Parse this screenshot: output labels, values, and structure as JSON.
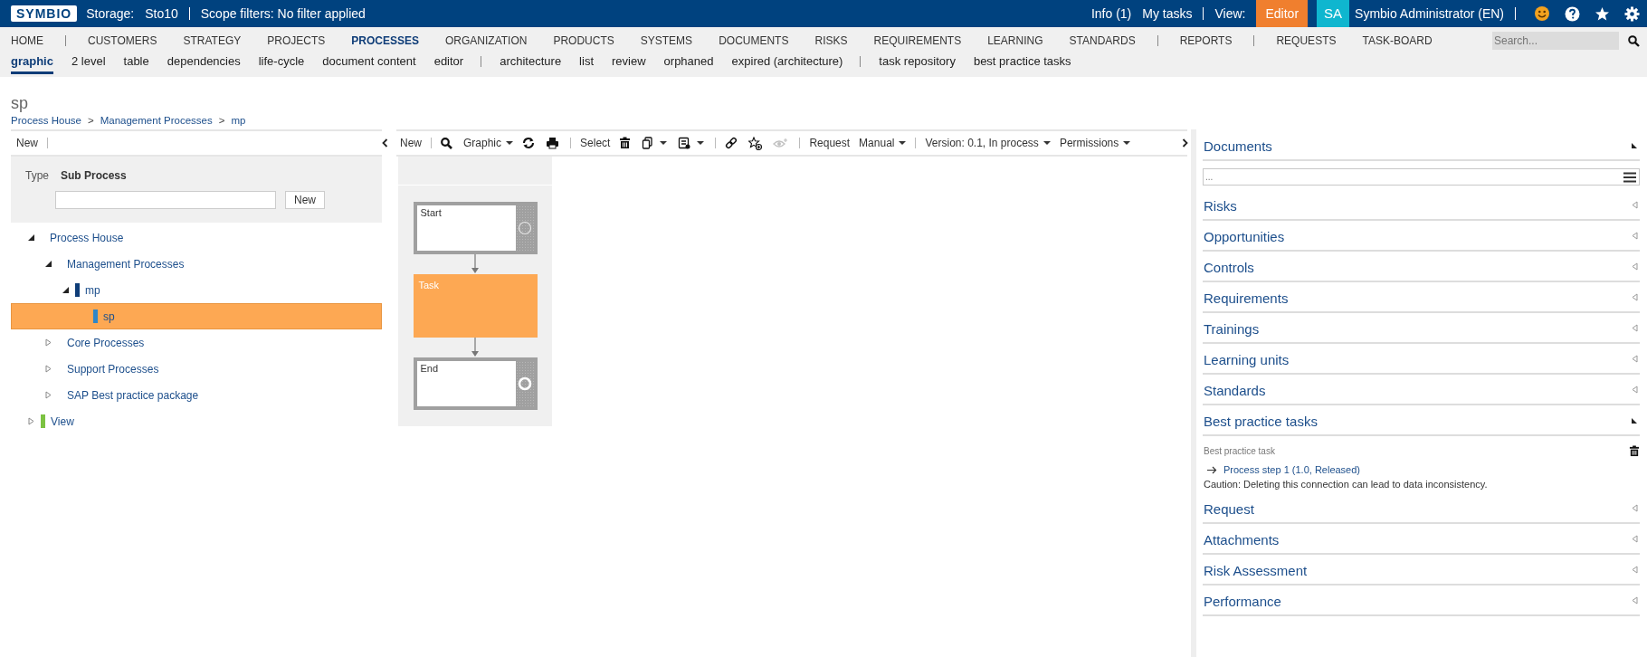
{
  "topbar": {
    "logo": "SYMBIO",
    "storage_label": "Storage:",
    "storage": "Sto10",
    "scope": "Scope filters: No filter applied",
    "info": "Info (1)",
    "my_tasks": "My tasks",
    "view_label": "View:",
    "view": "Editor",
    "avatar": "SA",
    "user": "Symbio Administrator (EN)"
  },
  "main_nav": [
    {
      "label": "HOME",
      "selected": false,
      "divider_after": true
    },
    {
      "label": "CUSTOMERS",
      "selected": false,
      "divider_after": false
    },
    {
      "label": "STRATEGY",
      "selected": false,
      "divider_after": false
    },
    {
      "label": "PROJECTS",
      "selected": false,
      "divider_after": false
    },
    {
      "label": "PROCESSES",
      "selected": true,
      "divider_after": false
    },
    {
      "label": "ORGANIZATION",
      "selected": false,
      "divider_after": false
    },
    {
      "label": "PRODUCTS",
      "selected": false,
      "divider_after": false
    },
    {
      "label": "SYSTEMS",
      "selected": false,
      "divider_after": false
    },
    {
      "label": "DOCUMENTS",
      "selected": false,
      "divider_after": false
    },
    {
      "label": "RISKS",
      "selected": false,
      "divider_after": false
    },
    {
      "label": "REQUIREMENTS",
      "selected": false,
      "divider_after": false
    },
    {
      "label": "LEARNING",
      "selected": false,
      "divider_after": false
    },
    {
      "label": "STANDARDS",
      "selected": false,
      "divider_after": true
    },
    {
      "label": "REPORTS",
      "selected": false,
      "divider_after": true
    },
    {
      "label": "REQUESTS",
      "selected": false,
      "divider_after": false
    },
    {
      "label": "TASK-BOARD",
      "selected": false,
      "divider_after": false
    }
  ],
  "search": {
    "placeholder": "Search..."
  },
  "sub_nav": [
    {
      "label": "graphic",
      "selected": true,
      "divider_after": false
    },
    {
      "label": "2 level",
      "selected": false,
      "divider_after": false
    },
    {
      "label": "table",
      "selected": false,
      "divider_after": false
    },
    {
      "label": "dependencies",
      "selected": false,
      "divider_after": false
    },
    {
      "label": "life-cycle",
      "selected": false,
      "divider_after": false
    },
    {
      "label": "document content",
      "selected": false,
      "divider_after": false
    },
    {
      "label": "editor",
      "selected": false,
      "divider_after": true
    },
    {
      "label": "architecture",
      "selected": false,
      "divider_after": false
    },
    {
      "label": "list",
      "selected": false,
      "divider_after": false
    },
    {
      "label": "review",
      "selected": false,
      "divider_after": false
    },
    {
      "label": "orphaned",
      "selected": false,
      "divider_after": false
    },
    {
      "label": "expired (architecture)",
      "selected": false,
      "divider_after": true
    },
    {
      "label": "task repository",
      "selected": false,
      "divider_after": false
    },
    {
      "label": "best practice tasks",
      "selected": false,
      "divider_after": false
    }
  ],
  "page": {
    "title": "sp",
    "breadcrumb": [
      "Process House",
      "Management Processes",
      "mp"
    ],
    "breadcrumb_separator": ">"
  },
  "left_panel": {
    "new_button": "New",
    "type_label": "Type",
    "type_value": "Sub Process",
    "create_button": "New",
    "tree": [
      {
        "label": "Process House",
        "expanded": true,
        "selected": false,
        "children": [
          {
            "label": "Management Processes",
            "expanded": true,
            "selected": false,
            "children": [
              {
                "label": "mp",
                "expanded": true,
                "selected": false,
                "color": "#0f3d78",
                "children": [
                  {
                    "label": "sp",
                    "selected": true,
                    "color": "#2f86c8"
                  }
                ]
              }
            ]
          },
          {
            "label": "Core Processes",
            "expanded": false,
            "selected": false
          },
          {
            "label": "Support Processes",
            "expanded": false,
            "selected": false
          },
          {
            "label": "SAP Best practice package",
            "expanded": false,
            "selected": false
          }
        ]
      },
      {
        "label": "View",
        "expanded": false,
        "selected": false,
        "color": "#7cc242"
      }
    ]
  },
  "toolbar": {
    "new": "New",
    "graphic": "Graphic",
    "select": "Select",
    "request": "Request",
    "manual": "Manual",
    "version": "Version: 0.1, In process",
    "permissions": "Permissions",
    "watch_disabled": true
  },
  "diagram": [
    {
      "kind": "start",
      "label": "Start"
    },
    {
      "kind": "task",
      "label": "Task"
    },
    {
      "kind": "end",
      "label": "End"
    }
  ],
  "right_panel": [
    {
      "title": "Documents",
      "expanded": true,
      "field": {
        "placeholder": "..."
      }
    },
    {
      "title": "Risks",
      "expanded": false
    },
    {
      "title": "Opportunities",
      "expanded": false
    },
    {
      "title": "Controls",
      "expanded": false
    },
    {
      "title": "Requirements",
      "expanded": false
    },
    {
      "title": "Trainings",
      "expanded": false
    },
    {
      "title": "Learning units",
      "expanded": false
    },
    {
      "title": "Standards",
      "expanded": false
    },
    {
      "title": "Best practice tasks",
      "expanded": true,
      "content": {
        "label": "Best practice task",
        "link": "Process step 1 (1.0, Released)",
        "caution": "Caution: Deleting this connection can lead to data inconsistency."
      }
    },
    {
      "title": "Request",
      "expanded": false
    },
    {
      "title": "Attachments",
      "expanded": false
    },
    {
      "title": "Risk Assessment",
      "expanded": false
    },
    {
      "title": "Performance",
      "expanded": false
    }
  ]
}
